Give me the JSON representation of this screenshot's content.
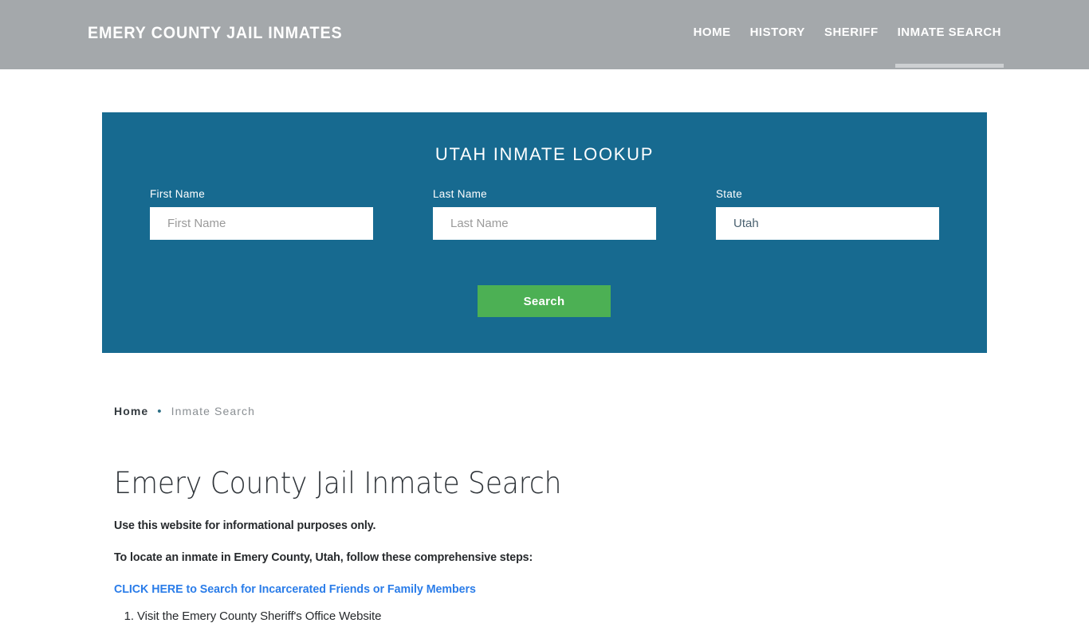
{
  "header": {
    "brand": "EMERY COUNTY JAIL INMATES",
    "nav": [
      {
        "label": "HOME",
        "active": false
      },
      {
        "label": "HISTORY",
        "active": false
      },
      {
        "label": "SHERIFF",
        "active": false
      },
      {
        "label": "INMATE SEARCH",
        "active": true
      }
    ]
  },
  "lookup": {
    "title": "UTAH INMATE LOOKUP",
    "first_name": {
      "label": "First Name",
      "placeholder": "First Name",
      "value": ""
    },
    "last_name": {
      "label": "Last Name",
      "placeholder": "Last Name",
      "value": ""
    },
    "state": {
      "label": "State",
      "value": "Utah"
    },
    "search_button": "Search",
    "panel_color": "#176a90",
    "button_color": "#4cb054"
  },
  "breadcrumb": {
    "home": "Home",
    "separator": "•",
    "current": "Inmate Search"
  },
  "main": {
    "title": "Emery County Jail Inmate Search",
    "paragraph_1": "Use this website for informational purposes only.",
    "paragraph_2": "To locate an inmate in Emery County, Utah, follow these comprehensive steps:",
    "cta_link": "CLICK HERE to Search for Incarcerated Friends or Family Members",
    "steps": [
      "Visit the Emery County Sheriff's Office Website"
    ],
    "link_color": "#2b7de9"
  }
}
